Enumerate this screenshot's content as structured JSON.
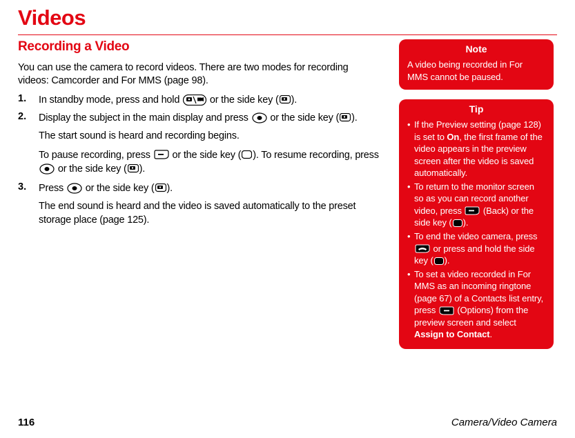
{
  "title": "Videos",
  "subtitle": "Recording a Video",
  "intro": "You can use the camera to record videos. There are two modes for recording videos: Camcorder and For MMS (page 98).",
  "steps": [
    {
      "num": "1.",
      "parts": [
        "In standby mode, press and hold ",
        " or the side key (",
        ")."
      ]
    },
    {
      "num": "2.",
      "parts": [
        "Display the subject in the main display and press ",
        " or the side key (",
        ")."
      ]
    },
    {
      "num": "3.",
      "parts": [
        "Press ",
        " or the side key (",
        ")."
      ]
    }
  ],
  "step2_sub1": "The start sound is heard and recording begins.",
  "step2_sub2a": "To pause recording, press ",
  "step2_sub2b": " or the side key (",
  "step2_sub2c": "). To resume recording, press ",
  "step2_sub2d": " or the side key (",
  "step2_sub2e": ").",
  "step3_sub": "The end sound is heard and the video is saved automatically to the preset storage place (page 125).",
  "note": {
    "title": "Note",
    "body": "A video being recorded in For MMS cannot be paused."
  },
  "tip": {
    "title": "Tip",
    "t1a": "If the Preview setting (page 128) is set to ",
    "t1b": "On",
    "t1c": ", the first frame of the video appears in the preview screen after the video is saved automatically.",
    "t2a": "To return to the monitor screen so as you can record another video, press ",
    "t2b": " (Back) or the side key (",
    "t2c": ").",
    "t3a": "To end the video camera, press ",
    "t3b": " or press and hold the side key (",
    "t3c": ").",
    "t4a": "To set a video recorded in For MMS as an incoming ringtone (page 67) of a Contacts list entry, press ",
    "t4b": " (Options) from the preview screen and select ",
    "t4c": "Assign to Contact",
    "t4d": "."
  },
  "footer": {
    "page": "116",
    "section": "Camera/Video Camera"
  }
}
